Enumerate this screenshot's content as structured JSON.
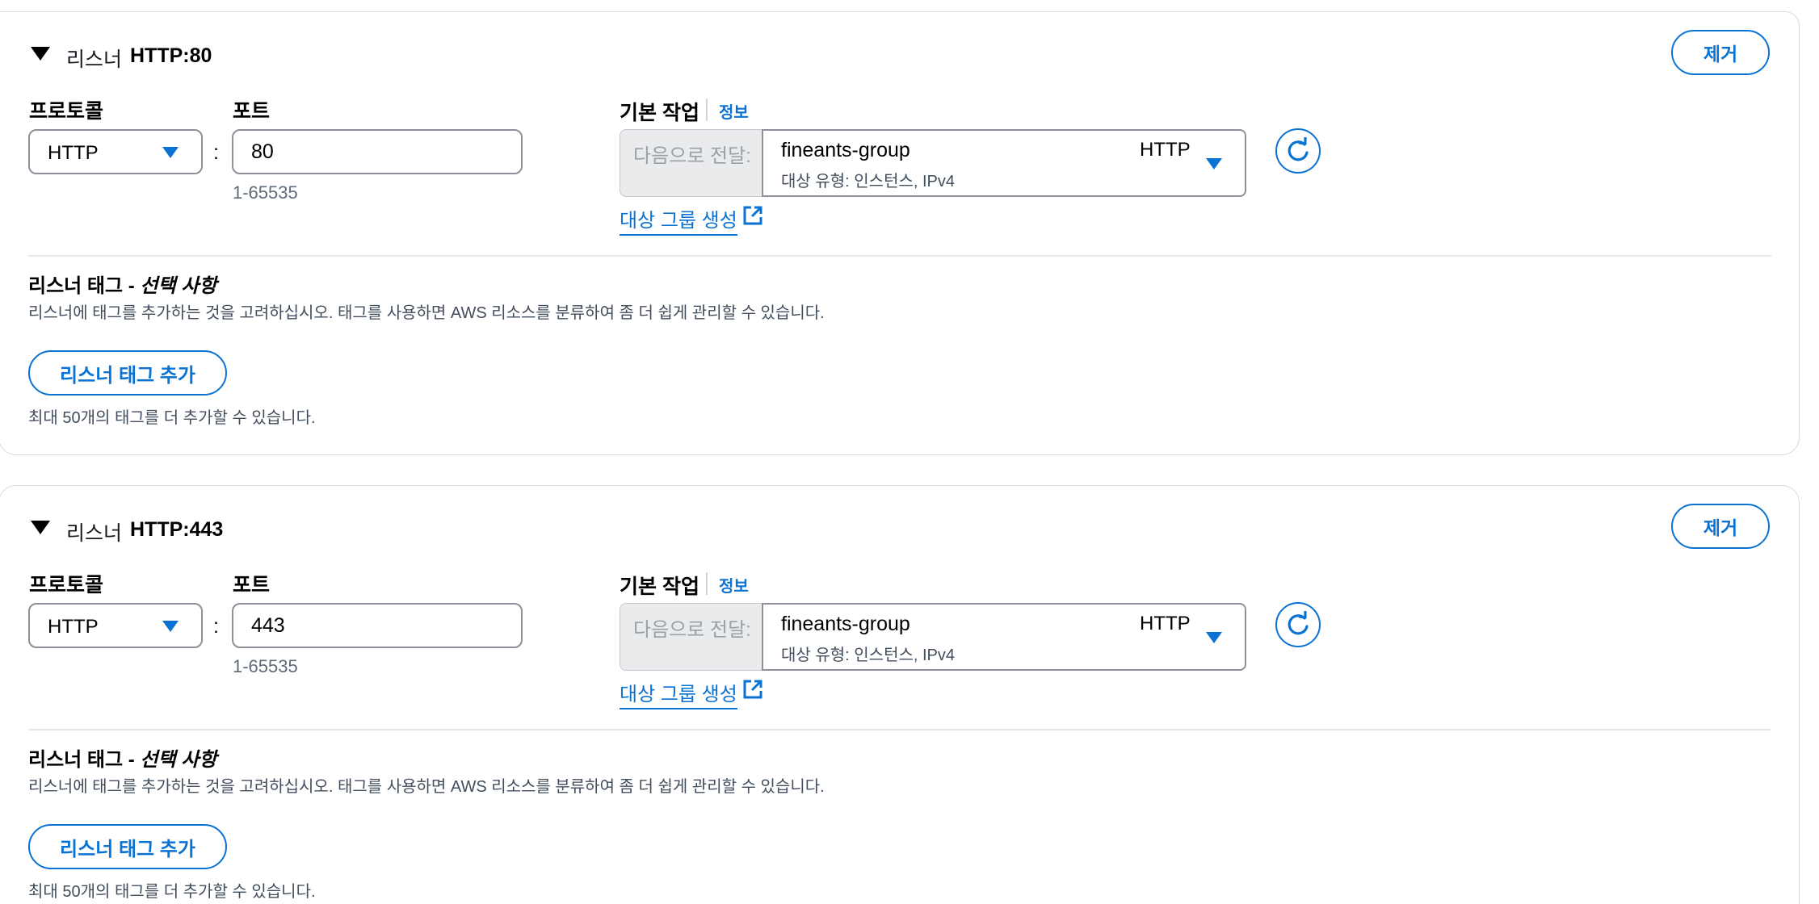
{
  "listeners": [
    {
      "header_label": "리스너",
      "header_value": "HTTP:80",
      "remove_label": "제거",
      "protocol_label": "프로토콜",
      "protocol_value": "HTTP",
      "port_label": "포트",
      "port_value": "80",
      "port_hint": "1-65535",
      "default_action_label": "기본 작업",
      "info_label": "정보",
      "forward_prefix": "다음으로 전달:",
      "target_group_name": "fineants-group",
      "target_group_protocol": "HTTP",
      "target_group_sub": "대상 유형: 인스턴스, IPv4",
      "create_target_group_link": "대상 그룹 생성",
      "tags_title": "리스너 태그 - ",
      "tags_title_optional": "선택 사항",
      "tags_desc": "리스너에 태그를 추가하는 것을 고려하십시오. 태그를 사용하면 AWS 리소스를 분류하여 좀 더 쉽게 관리할 수 있습니다.",
      "add_tag_label": "리스너 태그 추가",
      "tag_limit_note": "최대 50개의 태그를 더 추가할 수 있습니다."
    },
    {
      "header_label": "리스너",
      "header_value": "HTTP:443",
      "remove_label": "제거",
      "protocol_label": "프로토콜",
      "protocol_value": "HTTP",
      "port_label": "포트",
      "port_value": "443",
      "port_hint": "1-65535",
      "default_action_label": "기본 작업",
      "info_label": "정보",
      "forward_prefix": "다음으로 전달:",
      "target_group_name": "fineants-group",
      "target_group_protocol": "HTTP",
      "target_group_sub": "대상 유형: 인스턴스, IPv4",
      "create_target_group_link": "대상 그룹 생성",
      "tags_title": "리스너 태그 - ",
      "tags_title_optional": "선택 사항",
      "tags_desc": "리스너에 태그를 추가하는 것을 고려하십시오. 태그를 사용하면 AWS 리소스를 분류하여 좀 더 쉽게 관리할 수 있습니다.",
      "add_tag_label": "리스너 태그 추가",
      "tag_limit_note": "최대 50개의 태그를 더 추가할 수 있습니다."
    }
  ],
  "icons": {
    "expand": "caret-down-icon",
    "select": "chevron-down-icon",
    "refresh": "refresh-icon",
    "external": "external-link-icon"
  },
  "colors": {
    "accent": "#0972d3",
    "border": "#8d9199",
    "muted_bg": "#e9ebed"
  }
}
